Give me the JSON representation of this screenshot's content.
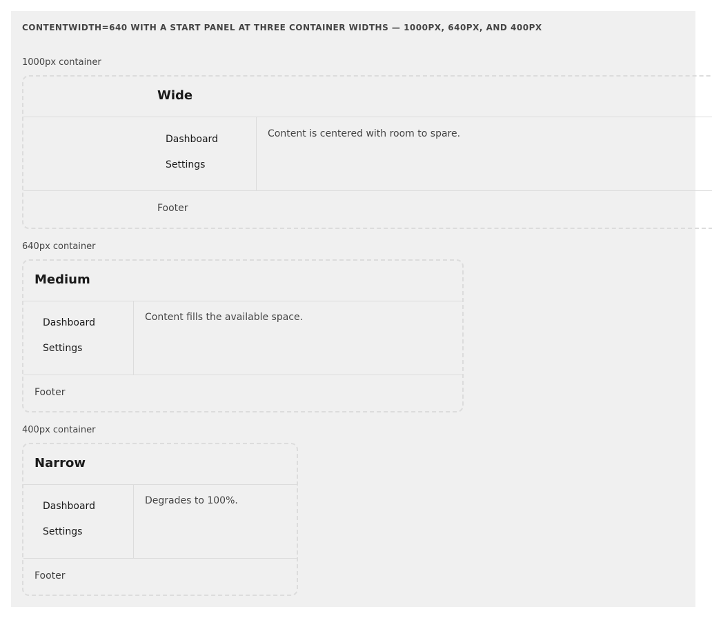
{
  "heading": "CONTENTWIDTH=640 WITH A START PANEL AT THREE CONTAINER WIDTHS — 1000PX, 640PX, AND 400PX",
  "panels": [
    {
      "caption": "1000px container",
      "title": "Wide",
      "nav": [
        "Dashboard",
        "Settings"
      ],
      "content": "Content is centered with room to spare.",
      "footer": "Footer"
    },
    {
      "caption": "640px container",
      "title": "Medium",
      "nav": [
        "Dashboard",
        "Settings"
      ],
      "content": "Content fills the available space.",
      "footer": "Footer"
    },
    {
      "caption": "400px container",
      "title": "Narrow",
      "nav": [
        "Dashboard",
        "Settings"
      ],
      "content": "Degrades to 100%.",
      "footer": "Footer"
    }
  ]
}
